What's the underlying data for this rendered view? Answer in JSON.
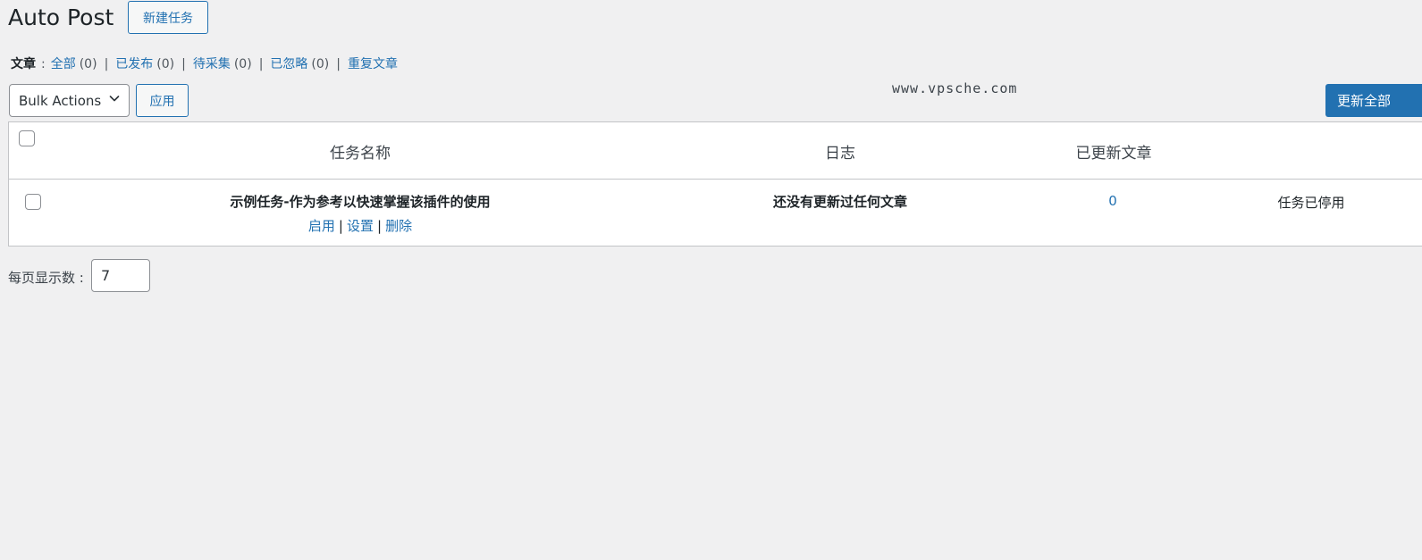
{
  "header": {
    "title": "Auto Post",
    "new_task_label": "新建任务"
  },
  "filters": {
    "label": "文章",
    "colon": ":",
    "items": [
      {
        "label": "全部",
        "count": "(0)"
      },
      {
        "label": "已发布",
        "count": "(0)"
      },
      {
        "label": "待采集",
        "count": "(0)"
      },
      {
        "label": "已忽略",
        "count": "(0)"
      },
      {
        "label": "重复文章",
        "count": ""
      }
    ],
    "separator": "|"
  },
  "toolbar": {
    "bulk_actions_value": "Bulk Actions",
    "apply_label": "应用",
    "watermark": "www.vpsche.com",
    "update_all_label": "更新全部"
  },
  "table": {
    "headers": {
      "task_name": "任务名称",
      "log": "日志",
      "updated_posts": "已更新文章"
    },
    "rows": [
      {
        "task_name": "示例任务-作为参考以快速掌握该插件的使用",
        "actions": [
          "启用",
          "设置",
          "删除"
        ],
        "log": "还没有更新过任何文章",
        "updated_count": "0",
        "status": "任务已停用"
      }
    ]
  },
  "pagination": {
    "per_page_label": "每页显示数 :",
    "per_page_value": "7"
  }
}
